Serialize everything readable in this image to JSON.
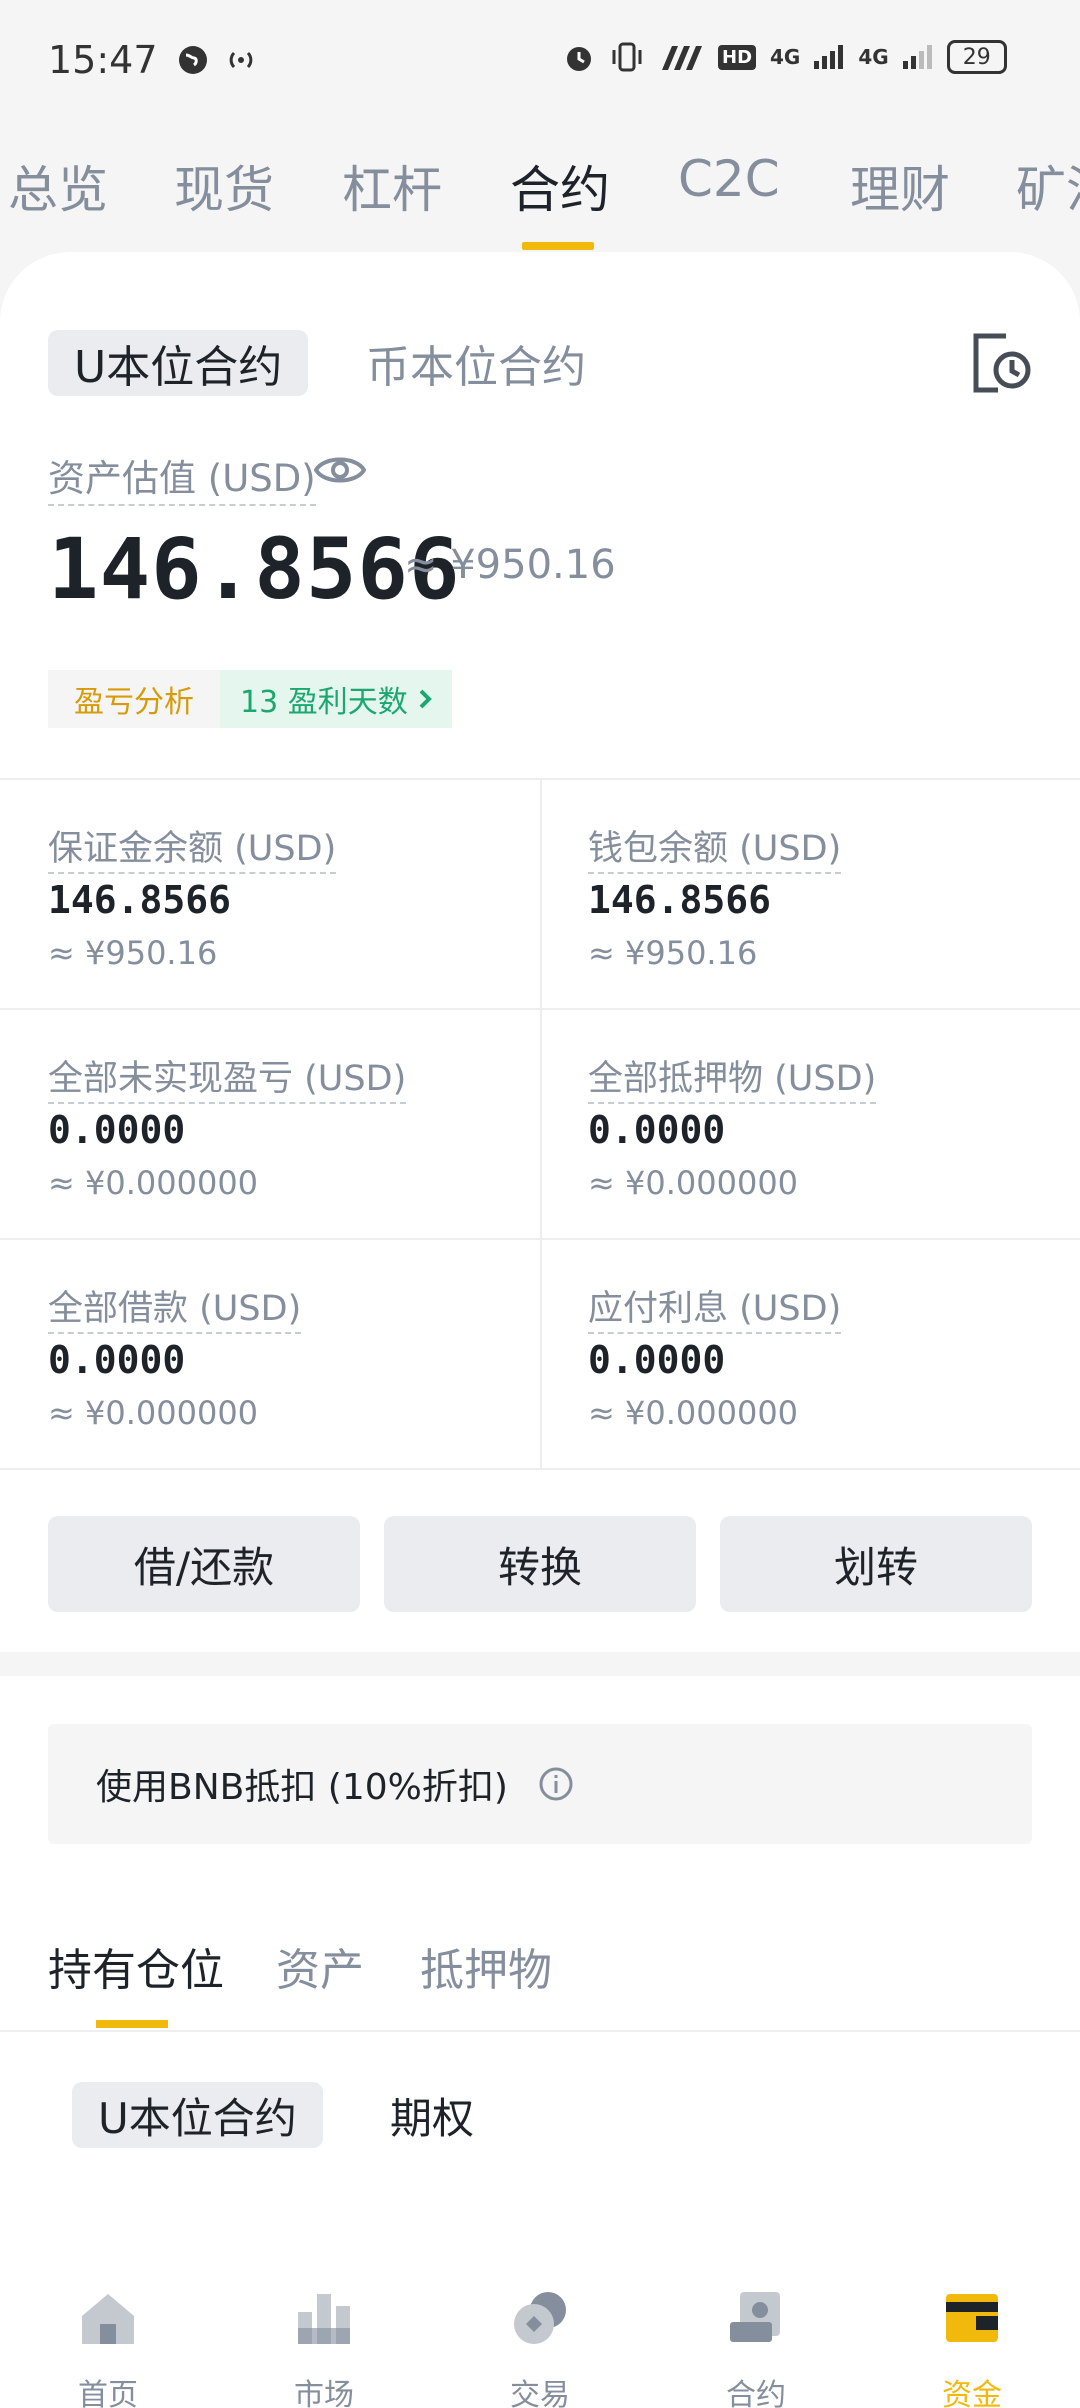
{
  "status_bar": {
    "time": "15:47",
    "battery": "29",
    "network_1": "4G",
    "network_2": "4G",
    "hd": "HD"
  },
  "top_tabs": [
    "总览",
    "现货",
    "杠杆",
    "合约",
    "C2C",
    "理财",
    "矿池"
  ],
  "top_tabs_active": "合约",
  "contract_type_tabs": {
    "usdt": "U本位合约",
    "coin": "币本位合约"
  },
  "asset": {
    "label": "资产估值 (USD)",
    "value": "146.8566",
    "approx": "≈ ¥950.16"
  },
  "pnl": {
    "analysis": "盈亏分析",
    "profit_days": "13 盈利天数"
  },
  "grid": [
    {
      "label": "保证金余额 (USD)",
      "value": "146.8566",
      "cny": "≈ ¥950.16"
    },
    {
      "label": "钱包余额 (USD)",
      "value": "146.8566",
      "cny": "≈ ¥950.16"
    },
    {
      "label": "全部未实现盈亏 (USD)",
      "value": "0.0000",
      "cny": "≈ ¥0.000000"
    },
    {
      "label": "全部抵押物 (USD)",
      "value": "0.0000",
      "cny": "≈ ¥0.000000"
    },
    {
      "label": "全部借款 (USD)",
      "value": "0.0000",
      "cny": "≈ ¥0.000000"
    },
    {
      "label": "应付利息 (USD)",
      "value": "0.0000",
      "cny": "≈ ¥0.000000"
    }
  ],
  "actions": {
    "borrow_repay": "借/还款",
    "convert": "转换",
    "transfer": "划转"
  },
  "bnb_deduction": "使用BNB抵扣 (10%折扣)",
  "holdings_tabs": {
    "positions": "持有仓位",
    "assets": "资产",
    "collateral": "抵押物"
  },
  "sub_tabs": {
    "usdt": "U本位合约",
    "options": "期权"
  },
  "bottom_nav": {
    "home": "首页",
    "market": "市场",
    "trade": "交易",
    "futures": "合约",
    "funds": "资金"
  },
  "colors": {
    "accent": "#f0b90b",
    "profit_green": "#1ba870",
    "text_primary": "#1e2329",
    "text_secondary": "#848e9c"
  }
}
